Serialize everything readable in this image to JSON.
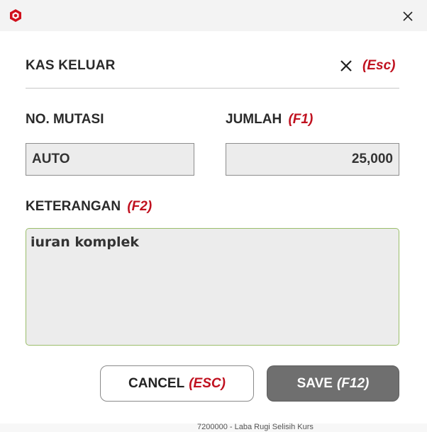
{
  "window": {
    "logo_icon": "app-logo-icon",
    "close_icon": "close-icon",
    "accent_color": "#c0111f"
  },
  "dialog": {
    "title": "KAS KELUAR",
    "close_key": "(Esc)"
  },
  "fields": {
    "no_mutasi": {
      "label": "NO. MUTASI",
      "value": "AUTO"
    },
    "jumlah": {
      "label": "JUMLAH",
      "key": "(F1)",
      "value": "25,000"
    },
    "keterangan": {
      "label": "KETERANGAN",
      "key": "(F2)",
      "value": "iuran komplek"
    }
  },
  "buttons": {
    "cancel": {
      "label": "CANCEL",
      "key": "(ESC)"
    },
    "save": {
      "label": "SAVE",
      "key": "(F12)",
      "color": "#6f6f6f"
    }
  },
  "background": {
    "partial_text": "7200000 - Laba Rugi Selisih Kurs"
  }
}
